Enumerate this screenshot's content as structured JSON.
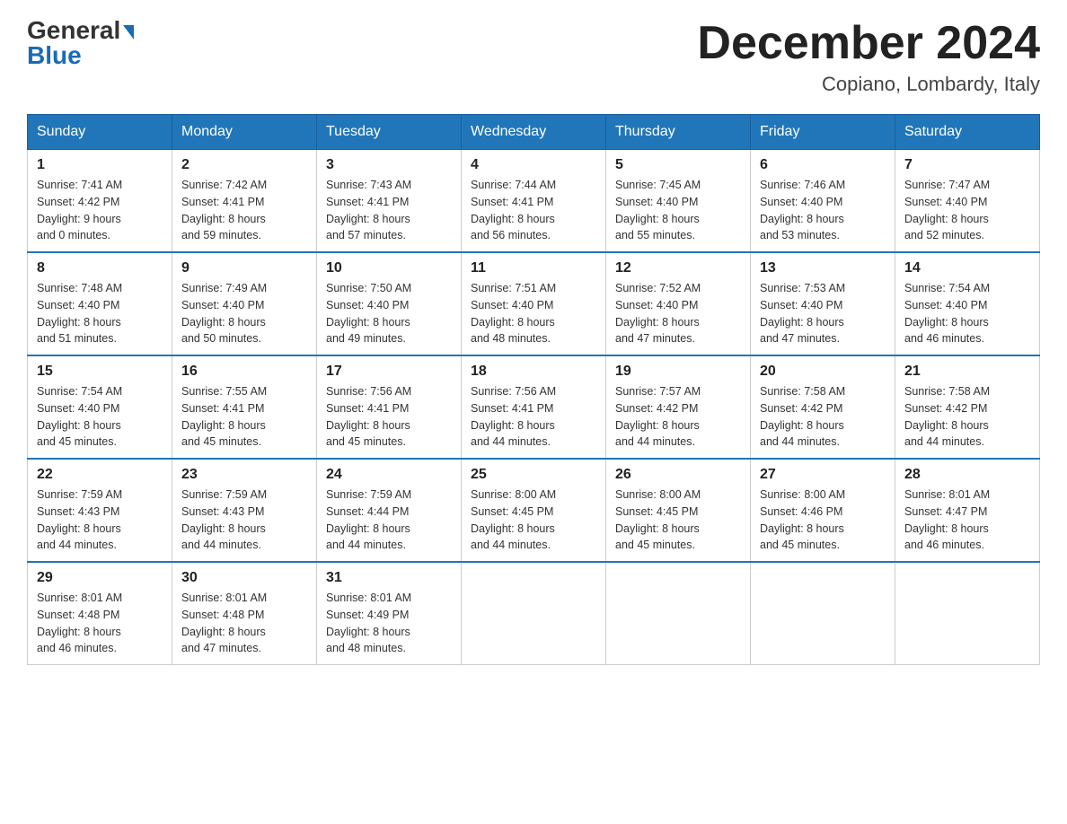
{
  "header": {
    "logo_general": "General",
    "logo_blue": "Blue",
    "month_title": "December 2024",
    "location": "Copiano, Lombardy, Italy"
  },
  "days_of_week": [
    "Sunday",
    "Monday",
    "Tuesday",
    "Wednesday",
    "Thursday",
    "Friday",
    "Saturday"
  ],
  "weeks": [
    [
      {
        "day": "1",
        "sunrise": "7:41 AM",
        "sunset": "4:42 PM",
        "daylight": "9 hours and 0 minutes."
      },
      {
        "day": "2",
        "sunrise": "7:42 AM",
        "sunset": "4:41 PM",
        "daylight": "8 hours and 59 minutes."
      },
      {
        "day": "3",
        "sunrise": "7:43 AM",
        "sunset": "4:41 PM",
        "daylight": "8 hours and 57 minutes."
      },
      {
        "day": "4",
        "sunrise": "7:44 AM",
        "sunset": "4:41 PM",
        "daylight": "8 hours and 56 minutes."
      },
      {
        "day": "5",
        "sunrise": "7:45 AM",
        "sunset": "4:40 PM",
        "daylight": "8 hours and 55 minutes."
      },
      {
        "day": "6",
        "sunrise": "7:46 AM",
        "sunset": "4:40 PM",
        "daylight": "8 hours and 53 minutes."
      },
      {
        "day": "7",
        "sunrise": "7:47 AM",
        "sunset": "4:40 PM",
        "daylight": "8 hours and 52 minutes."
      }
    ],
    [
      {
        "day": "8",
        "sunrise": "7:48 AM",
        "sunset": "4:40 PM",
        "daylight": "8 hours and 51 minutes."
      },
      {
        "day": "9",
        "sunrise": "7:49 AM",
        "sunset": "4:40 PM",
        "daylight": "8 hours and 50 minutes."
      },
      {
        "day": "10",
        "sunrise": "7:50 AM",
        "sunset": "4:40 PM",
        "daylight": "8 hours and 49 minutes."
      },
      {
        "day": "11",
        "sunrise": "7:51 AM",
        "sunset": "4:40 PM",
        "daylight": "8 hours and 48 minutes."
      },
      {
        "day": "12",
        "sunrise": "7:52 AM",
        "sunset": "4:40 PM",
        "daylight": "8 hours and 47 minutes."
      },
      {
        "day": "13",
        "sunrise": "7:53 AM",
        "sunset": "4:40 PM",
        "daylight": "8 hours and 47 minutes."
      },
      {
        "day": "14",
        "sunrise": "7:54 AM",
        "sunset": "4:40 PM",
        "daylight": "8 hours and 46 minutes."
      }
    ],
    [
      {
        "day": "15",
        "sunrise": "7:54 AM",
        "sunset": "4:40 PM",
        "daylight": "8 hours and 45 minutes."
      },
      {
        "day": "16",
        "sunrise": "7:55 AM",
        "sunset": "4:41 PM",
        "daylight": "8 hours and 45 minutes."
      },
      {
        "day": "17",
        "sunrise": "7:56 AM",
        "sunset": "4:41 PM",
        "daylight": "8 hours and 45 minutes."
      },
      {
        "day": "18",
        "sunrise": "7:56 AM",
        "sunset": "4:41 PM",
        "daylight": "8 hours and 44 minutes."
      },
      {
        "day": "19",
        "sunrise": "7:57 AM",
        "sunset": "4:42 PM",
        "daylight": "8 hours and 44 minutes."
      },
      {
        "day": "20",
        "sunrise": "7:58 AM",
        "sunset": "4:42 PM",
        "daylight": "8 hours and 44 minutes."
      },
      {
        "day": "21",
        "sunrise": "7:58 AM",
        "sunset": "4:42 PM",
        "daylight": "8 hours and 44 minutes."
      }
    ],
    [
      {
        "day": "22",
        "sunrise": "7:59 AM",
        "sunset": "4:43 PM",
        "daylight": "8 hours and 44 minutes."
      },
      {
        "day": "23",
        "sunrise": "7:59 AM",
        "sunset": "4:43 PM",
        "daylight": "8 hours and 44 minutes."
      },
      {
        "day": "24",
        "sunrise": "7:59 AM",
        "sunset": "4:44 PM",
        "daylight": "8 hours and 44 minutes."
      },
      {
        "day": "25",
        "sunrise": "8:00 AM",
        "sunset": "4:45 PM",
        "daylight": "8 hours and 44 minutes."
      },
      {
        "day": "26",
        "sunrise": "8:00 AM",
        "sunset": "4:45 PM",
        "daylight": "8 hours and 45 minutes."
      },
      {
        "day": "27",
        "sunrise": "8:00 AM",
        "sunset": "4:46 PM",
        "daylight": "8 hours and 45 minutes."
      },
      {
        "day": "28",
        "sunrise": "8:01 AM",
        "sunset": "4:47 PM",
        "daylight": "8 hours and 46 minutes."
      }
    ],
    [
      {
        "day": "29",
        "sunrise": "8:01 AM",
        "sunset": "4:48 PM",
        "daylight": "8 hours and 46 minutes."
      },
      {
        "day": "30",
        "sunrise": "8:01 AM",
        "sunset": "4:48 PM",
        "daylight": "8 hours and 47 minutes."
      },
      {
        "day": "31",
        "sunrise": "8:01 AM",
        "sunset": "4:49 PM",
        "daylight": "8 hours and 48 minutes."
      },
      null,
      null,
      null,
      null
    ]
  ]
}
